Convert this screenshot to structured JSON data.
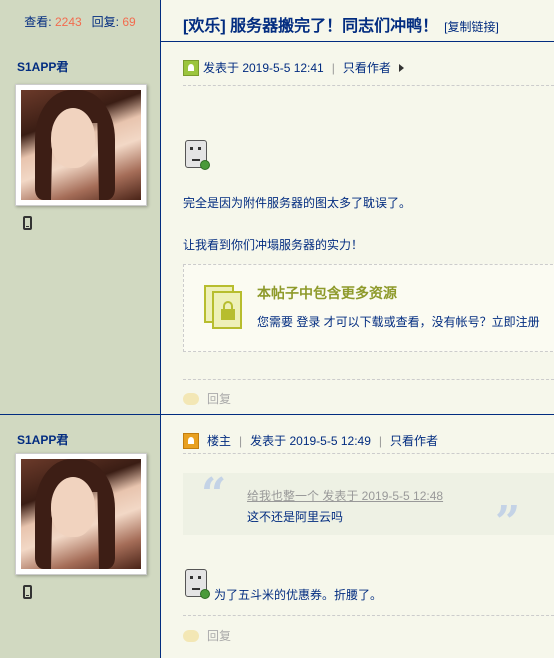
{
  "header": {
    "views_label": "查看:",
    "views_value": "2243",
    "replies_label": "回复:",
    "replies_value": "69",
    "thread_title": "[欢乐] 服务器搬完了！同志们冲鸭！",
    "copy_link": "[复制链接]"
  },
  "posts": [
    {
      "author": "S1APP君",
      "posted_at": "发表于 2019-5-5 12:41",
      "only_author": "只看作者",
      "line1": "完全是因为附件服务器的图太多了耽误了。",
      "line2": "让我看到你们冲塌服务器的实力！",
      "locked_title": "本帖子中包含更多资源",
      "locked_desc": "您需要 登录 才可以下载或查看，没有帐号？立即注册",
      "reply": "回复"
    },
    {
      "author": "S1APP君",
      "role": "楼主",
      "posted_at": "发表于 2019-5-5 12:49",
      "only_author": "只看作者",
      "quote_head": "给我也整一个 发表于 2019-5-5 12:48",
      "quote_body": "这不还是阿里云吗",
      "text": "为了五斗米的优惠券。折腰了。",
      "reply": "回复"
    }
  ],
  "colors": {
    "accent": "#022C80",
    "sidebar": "#D1D9C1",
    "count": "#F26C4F"
  }
}
